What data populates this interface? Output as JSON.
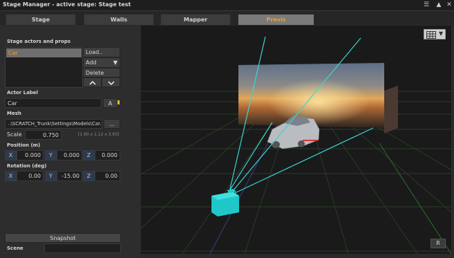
{
  "window": {
    "title": "Stage Manager - active stage: Stage test",
    "controls": [
      "menu-icon",
      "maximize-icon",
      "close-icon"
    ]
  },
  "tabs": [
    {
      "label": "Stage",
      "active": false
    },
    {
      "label": "Walls",
      "active": false
    },
    {
      "label": "Mapper",
      "active": false
    },
    {
      "label": "Previs",
      "active": true
    }
  ],
  "left_panel": {
    "actors_label": "Stage actors and props",
    "actors": [
      "Car"
    ],
    "selected_actor": "Car",
    "buttons": {
      "load": "Load..",
      "add": "Add",
      "delete": "Delete",
      "move_up_icon": "chevron-up-icon",
      "move_down_icon": "chevron-down-icon"
    },
    "actor_label_title": "Actor Label",
    "actor_label_value": "Car",
    "actor_label_button": "A",
    "mesh_title": "Mesh",
    "mesh_path": "..\\SCRATCH_Trunk\\Settings\\Models\\Car.obj",
    "mesh_browse": "...",
    "scale_label": "Scale",
    "scale_value": "0.750",
    "dimensions": "[1.60 x 1.12 x 3.60]",
    "position_title": "Position (m)",
    "position": {
      "x_label": "X",
      "x": "0.000",
      "y_label": "Y",
      "y": "0.000",
      "z_label": "Z",
      "z": "0.000"
    },
    "rotation_title": "Rotation (deg)",
    "rotation": {
      "x_label": "X",
      "x": "0.00",
      "y_label": "Y",
      "y": "-15.00",
      "z_label": "Z",
      "z": "0.00"
    },
    "snapshot_button": "Snapshot",
    "scene_label": "Scene",
    "scene_value": ""
  },
  "viewport": {
    "grid_toggle_icon": "grid-icon",
    "dropdown_icon": "caret-down-icon",
    "reset_button": "R",
    "accent_color": "#f0a020",
    "frustum_color": "#3ad6d6",
    "grid_color": "#3a6e2e"
  }
}
